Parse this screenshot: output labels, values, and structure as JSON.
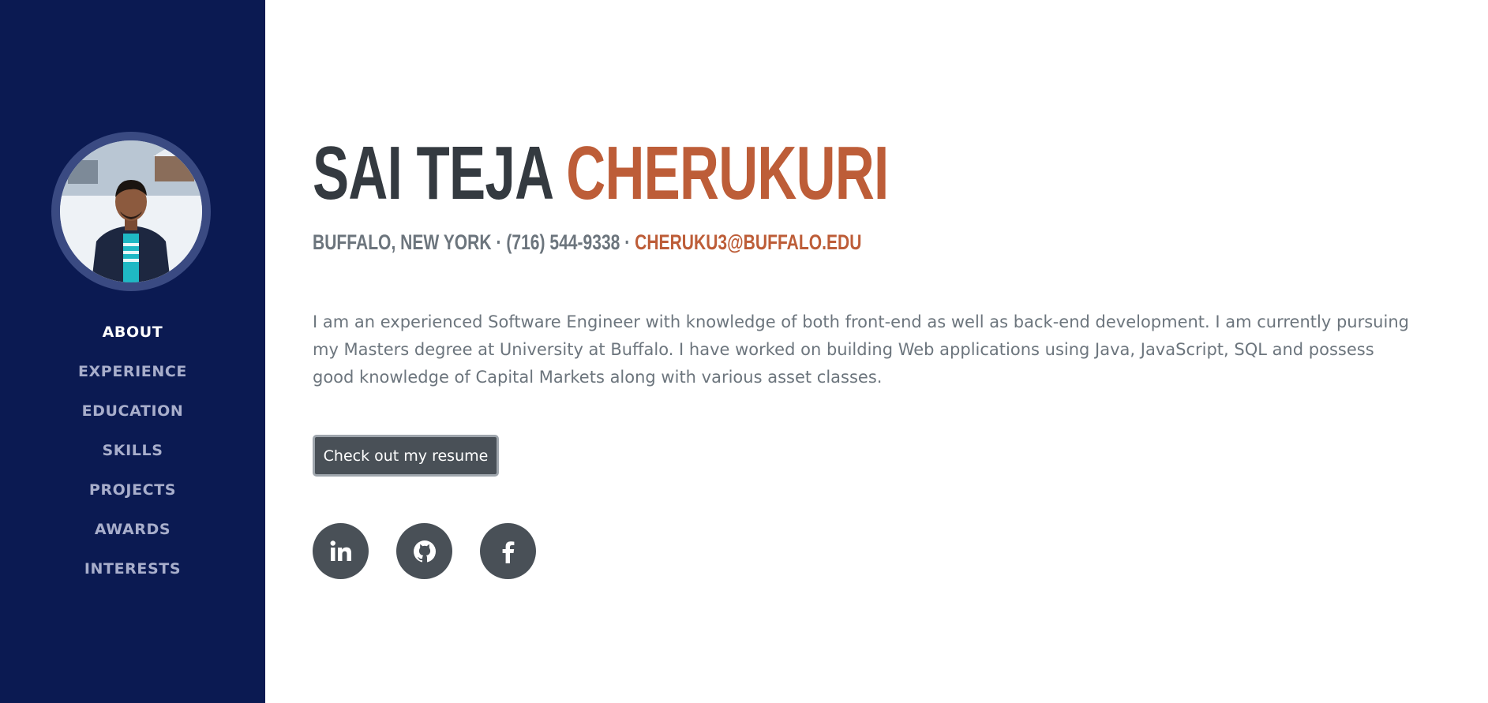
{
  "sidebar": {
    "nav": [
      {
        "label": "ABOUT",
        "active": true
      },
      {
        "label": "EXPERIENCE",
        "active": false
      },
      {
        "label": "EDUCATION",
        "active": false
      },
      {
        "label": "SKILLS",
        "active": false
      },
      {
        "label": "PROJECTS",
        "active": false
      },
      {
        "label": "AWARDS",
        "active": false
      },
      {
        "label": "INTERESTS",
        "active": false
      }
    ]
  },
  "header": {
    "first_name": "SAI TEJA",
    "last_name": "CHERUKURI",
    "location": "BUFFALO, NEW YORK",
    "separator": "·",
    "phone": "(716) 544-9338",
    "email": "CHERUKU3@BUFFALO.EDU"
  },
  "about": {
    "bio": "I am an experienced Software Engineer with knowledge of both front-end as well as back-end development. I am currently pursuing my Masters degree at University at Buffalo. I have worked on building Web applications using Java, JavaScript, SQL and possess good knowledge of Capital Markets along with various asset classes."
  },
  "actions": {
    "resume_label": "Check out my resume"
  },
  "social": [
    {
      "icon": "linkedin-icon"
    },
    {
      "icon": "github-icon"
    },
    {
      "icon": "facebook-icon"
    }
  ],
  "colors": {
    "sidebar_bg": "#0b1a52",
    "accent": "#bd5d38",
    "heading": "#343a40",
    "muted": "#6c757d",
    "button": "#495057"
  }
}
